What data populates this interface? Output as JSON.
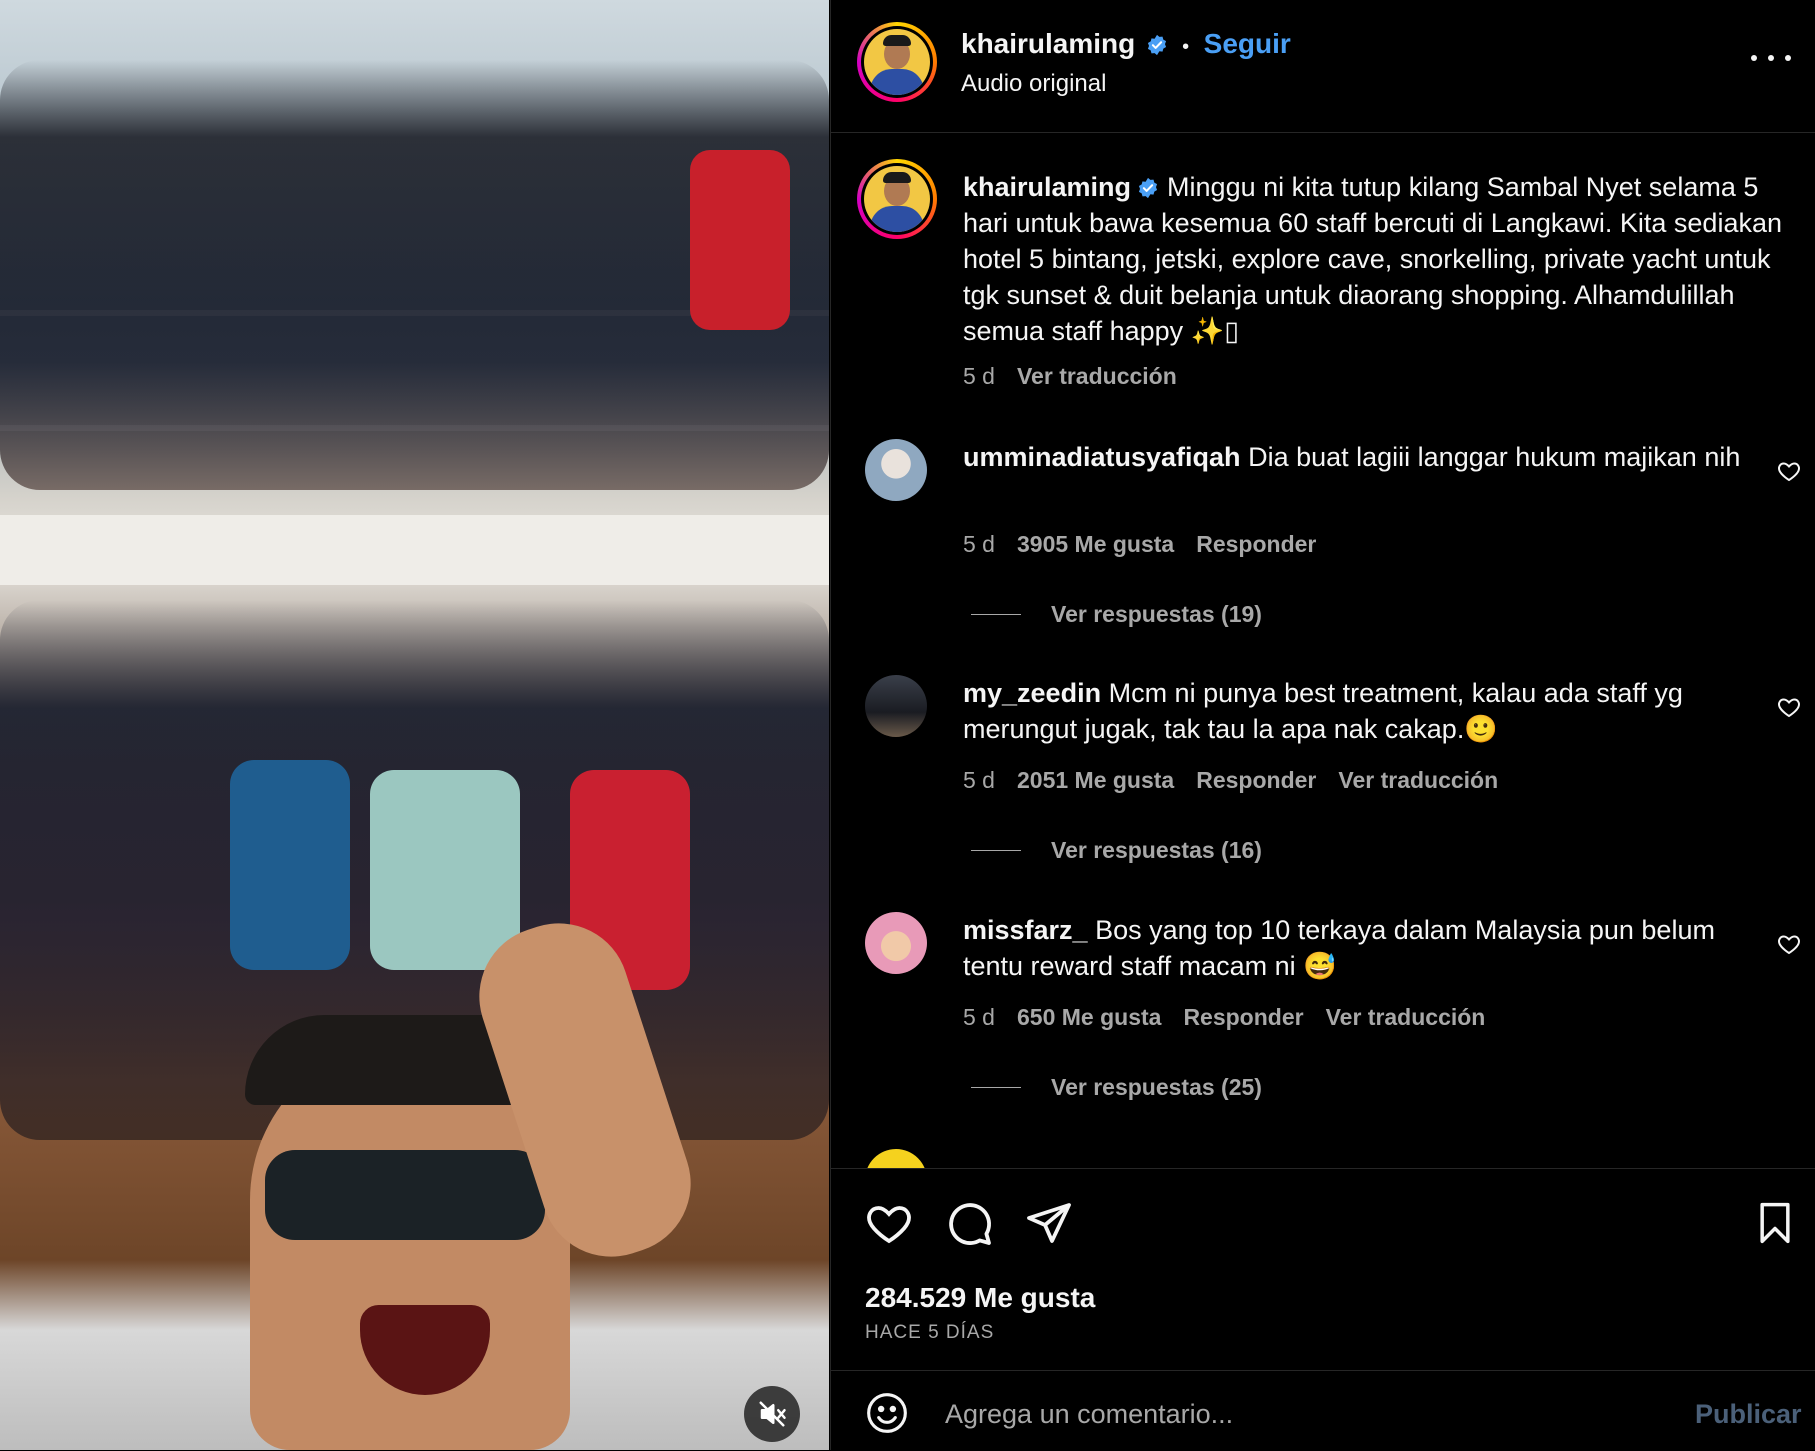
{
  "post": {
    "media_alt": "group of staff cheering on a yacht",
    "mute_icon": "speaker-muted-icon"
  },
  "header": {
    "username": "khairulaming",
    "separator": "•",
    "follow_label": "Seguir",
    "subtitle": "Audio original"
  },
  "caption": {
    "username": "khairulaming",
    "text": "Minggu ni kita tutup kilang Sambal Nyet selama 5 hari untuk bawa kesemua 60 staff bercuti di Langkawi. Kita sediakan hotel 5 bintang, jetski, explore cave, snorkelling, private yacht untuk tgk sunset & duit belanja untuk diaorang shopping. Alhamdulillah semua staff happy ✨▯",
    "time": "5 d",
    "translate_label": "Ver traducción"
  },
  "comments": [
    {
      "username": "umminadiatusyafiqah",
      "text": "Dia buat lagiii langgar hukum majikan nih",
      "time": "5 d",
      "likes": "3905 Me gusta",
      "reply_label": "Responder",
      "translate_label": "",
      "replies_label": "Ver respuestas (19)"
    },
    {
      "username": "my_zeedin",
      "text": "Mcm ni punya best treatment, kalau ada staff yg merungut jugak, tak tau la apa nak cakap.🙂",
      "time": "5 d",
      "likes": "2051 Me gusta",
      "reply_label": "Responder",
      "translate_label": "Ver traducción",
      "replies_label": "Ver respuestas (16)"
    },
    {
      "username": "missfarz_",
      "text": "Bos yang top 10 terkaya dalam Malaysia pun belum tentu reward staff macam ni 😅",
      "time": "5 d",
      "likes": "650 Me gusta",
      "reply_label": "Responder",
      "translate_label": "Ver traducción",
      "replies_label": "Ver respuestas (25)"
    }
  ],
  "footer": {
    "likes": "284.529 Me gusta",
    "date": "HACE 5 DÍAS",
    "comment_placeholder": "Agrega un comentario...",
    "publish_label": "Publicar"
  },
  "colors": {
    "link_blue": "#4a9ff5",
    "muted_text": "#a8a8a8",
    "publish_disabled": "#4b6079"
  }
}
